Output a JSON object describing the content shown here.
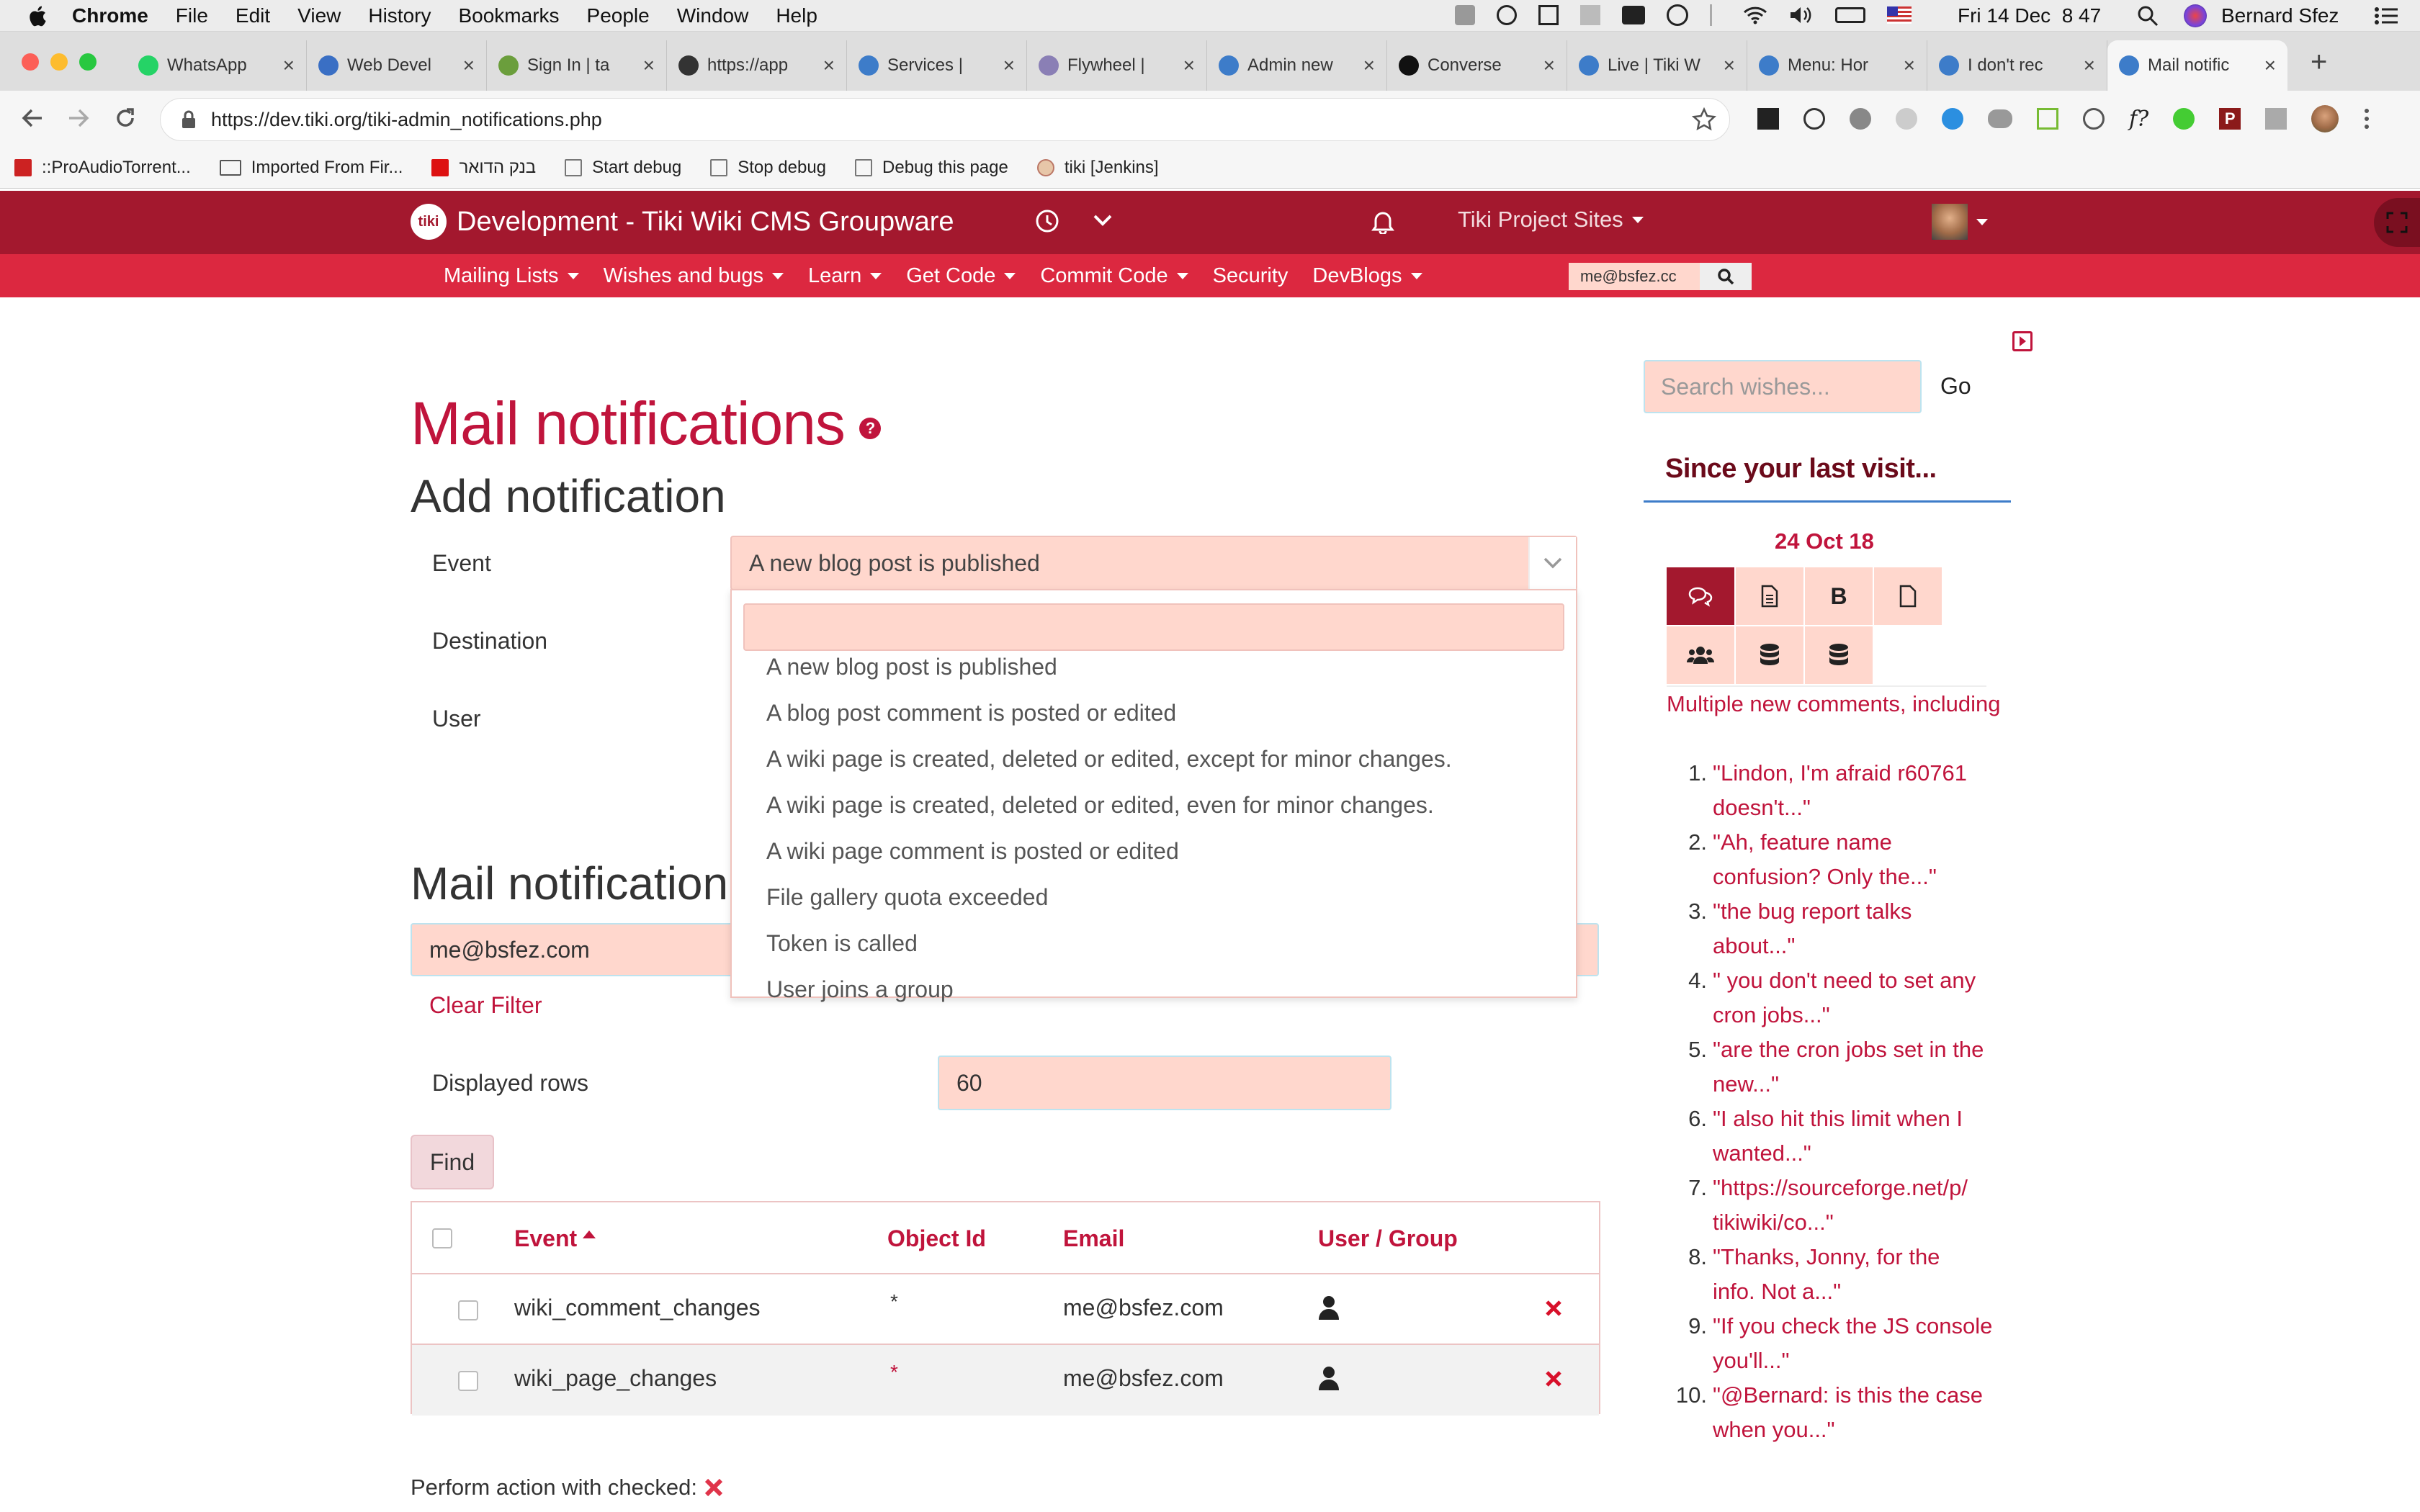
{
  "menubar": {
    "app": "Chrome",
    "items": [
      "File",
      "Edit",
      "View",
      "History",
      "Bookmarks",
      "People",
      "Window",
      "Help"
    ],
    "datetime": "Fri 14 Dec  8 47",
    "user": "Bernard Sfez"
  },
  "tabs": [
    {
      "label": "WhatsApp",
      "color": "#25d366"
    },
    {
      "label": "Web Devel",
      "color": "#3a6fc4"
    },
    {
      "label": "Sign In | ta",
      "color": "#6b9e3c"
    },
    {
      "label": "https://app",
      "color": "#333333"
    },
    {
      "label": "Services |",
      "color": "#3d7cc9"
    },
    {
      "label": "Flywheel |",
      "color": "#8a7fb5"
    },
    {
      "label": "Admin new",
      "color": "#3d7cc9"
    },
    {
      "label": "Converse",
      "color": "#111111"
    },
    {
      "label": "Live | Tiki W",
      "color": "#3d7cc9"
    },
    {
      "label": "Menu: Hor",
      "color": "#3d7cc9"
    },
    {
      "label": "I don't rec",
      "color": "#3d7cc9"
    },
    {
      "label": "Mail notific",
      "color": "#3d7cc9"
    }
  ],
  "address": {
    "url": "https://dev.tiki.org/tiki-admin_notifications.php"
  },
  "bookmarks": [
    "::ProAudioTorrent...",
    "Imported From Fir...",
    "בנק הדואר",
    "Start debug",
    "Stop debug",
    "Debug this page",
    "tiki [Jenkins]"
  ],
  "site": {
    "title": "Development - Tiki Wiki CMS Groupware",
    "project_sites": "Tiki Project Sites",
    "search_value": "me@bsfez.cc",
    "logo_text": "tiki"
  },
  "nav": [
    "Mailing Lists",
    "Wishes and bugs",
    "Learn",
    "Get Code",
    "Commit Code",
    "Security",
    "DevBlogs"
  ],
  "nav_carets": [
    true,
    true,
    true,
    true,
    true,
    false,
    true
  ],
  "page": {
    "title": "Mail notifications",
    "add_heading": "Add notification",
    "event_label": "Event",
    "destination_label": "Destination",
    "user_label": "User",
    "event_selected": "A new blog post is published",
    "dropdown_options": [
      "A new blog post is published",
      "A blog post comment is posted or edited",
      "A wiki page is created, deleted or edited, except for minor changes.",
      "A wiki page is created, deleted or edited, even for minor changes.",
      "A wiki page comment is posted or edited",
      "File gallery quota exceeded",
      "Token is called",
      "User joins a group"
    ],
    "list_heading": "Mail notification",
    "filter_value": "me@bsfez.com",
    "clear_filter": "Clear Filter",
    "rows_label": "Displayed rows",
    "rows_value": "60",
    "find_button": "Find",
    "table": {
      "headers": [
        "Event",
        "Object Id",
        "Email",
        "User / Group"
      ],
      "rows": [
        {
          "event": "wiki_comment_changes",
          "object": "*",
          "email": "me@bsfez.com"
        },
        {
          "event": "wiki_page_changes",
          "object": "*",
          "email": "me@bsfez.com"
        }
      ]
    },
    "perform_label": "Perform action with checked:"
  },
  "sidebar": {
    "search_placeholder": "Search wishes...",
    "go": "Go",
    "heading": "Since your last visit...",
    "date": "24 Oct 18",
    "summary": "Multiple new comments, including",
    "comments": [
      [
        "\"Lindon, I'm afraid r60761",
        "doesn't...\""
      ],
      [
        "\"Ah, feature name",
        "confusion? Only the...\""
      ],
      [
        "\"the bug report talks",
        "about...\""
      ],
      [
        "\" you don't need to set any",
        "cron jobs...\""
      ],
      [
        "\"are the cron jobs set in the",
        "new...\""
      ],
      [
        "\"I also hit this limit when I",
        "wanted...\""
      ],
      [
        "\"https://sourceforge.net/p/",
        "tikiwiki/co...\""
      ],
      [
        "\"Thanks, Jonny, for the",
        "info. Not a...\""
      ],
      [
        "\"If you check the JS console",
        "you'll...\""
      ],
      [
        "\"@Bernard: is this the case",
        "when you...\""
      ]
    ]
  },
  "colors": {
    "brand_dark": "#a3182e",
    "brand": "#dc2840",
    "accent": "#c0143c",
    "field": "#ffd7cd"
  }
}
